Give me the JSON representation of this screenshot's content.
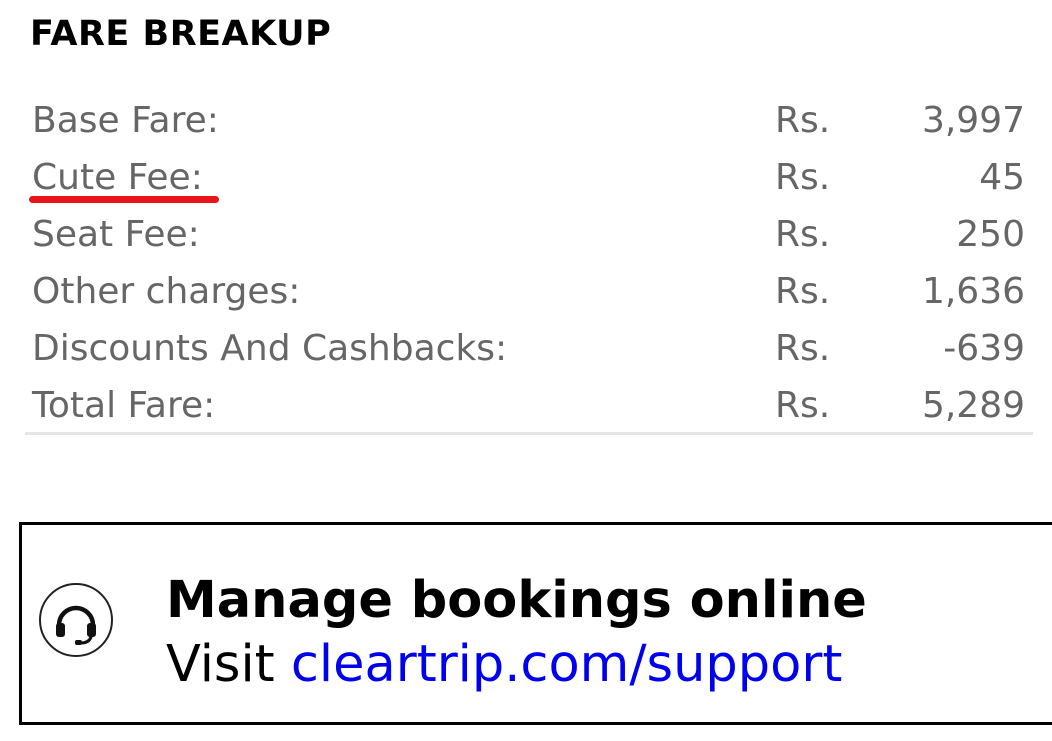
{
  "section": {
    "title": "FARE BREAKUP"
  },
  "fare_rows": [
    {
      "label": "Base Fare:",
      "currency": "Rs.",
      "amount": "3,997"
    },
    {
      "label": "Cute Fee:",
      "currency": "Rs.",
      "amount": "45"
    },
    {
      "label": "Seat Fee:",
      "currency": "Rs.",
      "amount": "250"
    },
    {
      "label": "Other charges:",
      "currency": "Rs.",
      "amount": "1,636"
    },
    {
      "label": "Discounts And Cashbacks:",
      "currency": "Rs.",
      "amount": "-639"
    },
    {
      "label": "Total Fare:",
      "currency": "Rs.",
      "amount": "5,289"
    }
  ],
  "support": {
    "icon": "headset-icon",
    "heading": "Manage bookings online",
    "prefix": "Visit ",
    "link_text": "cleartrip.com/support"
  },
  "colors": {
    "label_text": "#666666",
    "highlight": "#e8141a",
    "link": "#0000ee"
  }
}
